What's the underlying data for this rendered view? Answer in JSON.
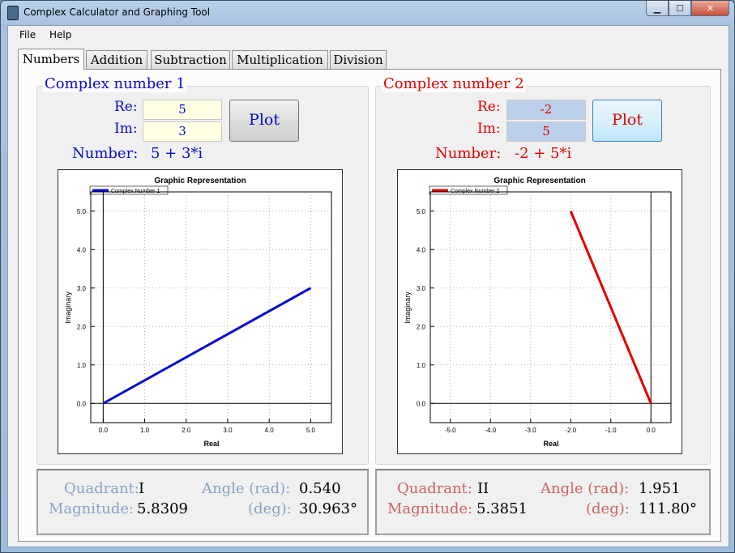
{
  "window": {
    "title": "Complex Calculator and Graphing Tool",
    "controls": {
      "minimize": "▁",
      "maximize": "☐",
      "close": "✕"
    }
  },
  "menu": [
    "File",
    "Help"
  ],
  "tabs": [
    "Numbers",
    "Addition",
    "Subtraction",
    "Multiplication",
    "Division"
  ],
  "colors": {
    "num1": "#0a0acb",
    "num2": "#e00000",
    "info1": "#87a2c3",
    "info2": "#c86464"
  },
  "num1": {
    "group_title": "Complex number 1",
    "re_label": "Re:",
    "im_label": "Im:",
    "re": "5",
    "im": "3",
    "plot_label": "Plot",
    "number_label": "Number:",
    "number_value": "5 + 3*i",
    "info": {
      "quadrant_label": "Quadrant:",
      "quadrant": "I",
      "magnitude_label": "Magnitude:",
      "magnitude": "5.8309",
      "angle_rad_label": "Angle (rad):",
      "angle_rad": "0.540",
      "angle_deg_label": "(deg):",
      "angle_deg": "30.963°"
    }
  },
  "num2": {
    "group_title": "Complex number 2",
    "re_label": "Re:",
    "im_label": "Im:",
    "re": "-2",
    "im": "5",
    "plot_label": "Plot",
    "number_label": "Number:",
    "number_value": "-2 + 5*i",
    "info": {
      "quadrant_label": "Quadrant:",
      "quadrant": "II",
      "magnitude_label": "Magnitude:",
      "magnitude": "5.3851",
      "angle_rad_label": "Angle (rad):",
      "angle_rad": "1.951",
      "angle_deg_label": "(deg):",
      "angle_deg": "111.80°"
    }
  },
  "chart_data": [
    {
      "type": "line",
      "title": "Graphic Representation",
      "xlabel": "Real",
      "ylabel": "Imaginary",
      "xlim": [
        -0.3,
        5.5
      ],
      "ylim": [
        -0.5,
        5.5
      ],
      "xticks": [
        "0.0",
        "1.0",
        "2.0",
        "3.0",
        "4.0",
        "5.0"
      ],
      "yticks": [
        "0.0",
        "1.0",
        "2.0",
        "3.0",
        "4.0",
        "5.0"
      ],
      "grid": true,
      "legend": "top-left",
      "series": [
        {
          "name": "Complex Number 1",
          "color": "#0a0acb",
          "x": [
            0,
            5
          ],
          "y": [
            0,
            3
          ]
        }
      ]
    },
    {
      "type": "line",
      "title": "Graphic Representation",
      "xlabel": "Real",
      "ylabel": "Imaginary",
      "xlim": [
        -5.5,
        0.5
      ],
      "ylim": [
        -0.5,
        5.5
      ],
      "xticks": [
        "-5.0",
        "-4.0",
        "-3.0",
        "-2.0",
        "-1.0",
        "0.0"
      ],
      "yticks": [
        "0.0",
        "1.0",
        "2.0",
        "3.0",
        "4.0",
        "5.0"
      ],
      "grid": true,
      "legend": "top-left",
      "series": [
        {
          "name": "Complex Number 2",
          "color": "#e00000",
          "x": [
            0,
            -2
          ],
          "y": [
            0,
            5
          ]
        }
      ]
    }
  ]
}
